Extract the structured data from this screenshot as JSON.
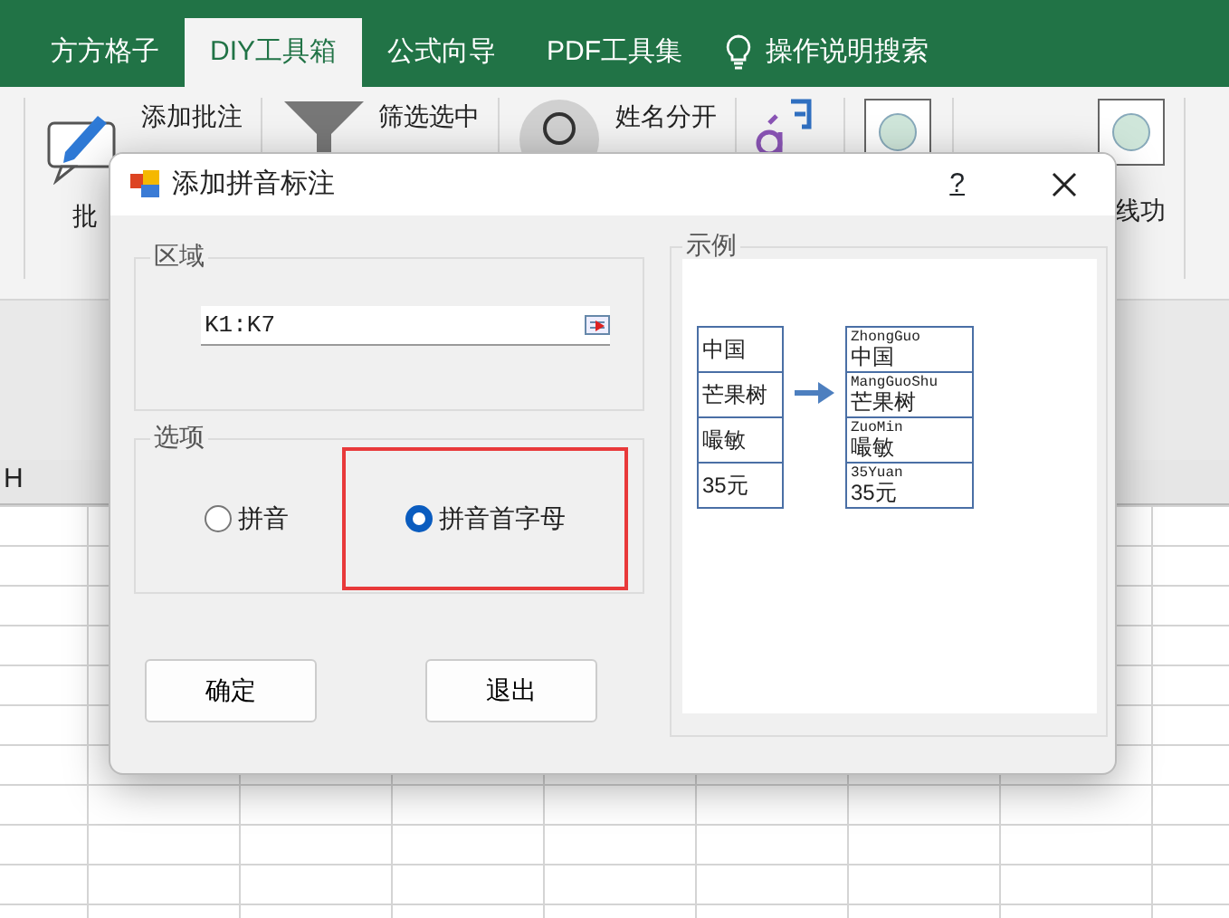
{
  "tabs": [
    {
      "label": "方方格子",
      "selected": false
    },
    {
      "label": "DIY工具箱",
      "selected": true
    },
    {
      "label": "公式向导",
      "selected": false
    },
    {
      "label": "PDF工具集",
      "selected": false
    }
  ],
  "tell_me": {
    "label": "操作说明搜索"
  },
  "ribbon": {
    "items": [
      {
        "label": "添加批注",
        "kind": "comment"
      },
      {
        "label": "筛选选中",
        "kind": "filter"
      },
      {
        "label": "姓名分开",
        "kind": "person"
      }
    ],
    "partial_labels": [
      "批",
      "线功"
    ]
  },
  "sheet": {
    "column_header": "H"
  },
  "dialog": {
    "title": "添加拼音标注",
    "help": "?",
    "region": {
      "legend": "区域",
      "value": "K1:K7"
    },
    "options": {
      "legend": "选项",
      "radios": [
        {
          "label": "拼音",
          "selected": false,
          "annotated": false
        },
        {
          "label": "拼音首字母",
          "selected": true,
          "annotated": true
        }
      ]
    },
    "buttons": [
      "确定",
      "退出"
    ],
    "example": {
      "legend": "示例",
      "source": [
        "中国",
        "芒果树",
        "嘬敏",
        "35元"
      ],
      "result": [
        {
          "pinyin": "ZhongGuo",
          "text": "中国"
        },
        {
          "pinyin": "MangGuoShu",
          "text": "芒果树"
        },
        {
          "pinyin": "ZuoMin",
          "text": "嘬敏"
        },
        {
          "pinyin": "35Yuan",
          "text": "35元"
        }
      ]
    }
  }
}
